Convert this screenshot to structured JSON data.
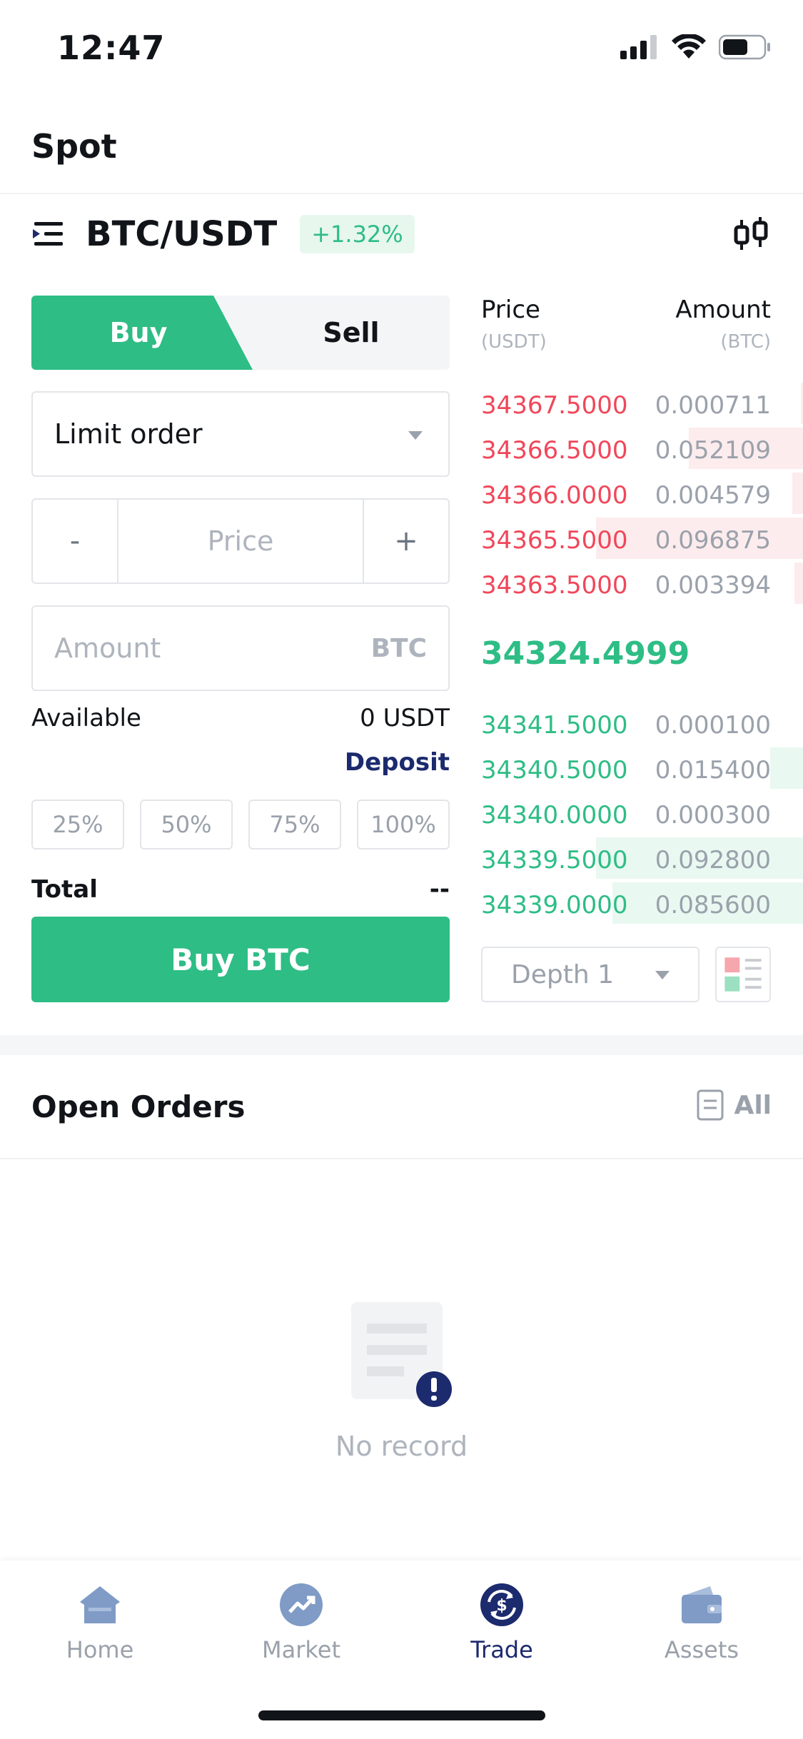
{
  "status": {
    "time": "12:47"
  },
  "header": {
    "title": "Spot"
  },
  "pair": {
    "name": "BTC/USDT",
    "change": "+1.32%"
  },
  "tabs": {
    "buy": "Buy",
    "sell": "Sell"
  },
  "form": {
    "order_type": "Limit order",
    "price_minus": "-",
    "price_placeholder": "Price",
    "price_plus": "+",
    "amount_placeholder": "Amount",
    "amount_unit": "BTC",
    "available_label": "Available",
    "available_value": "0 USDT",
    "deposit": "Deposit",
    "percentages": [
      "25%",
      "50%",
      "75%",
      "100%"
    ],
    "total_label": "Total",
    "total_value": "--",
    "submit": "Buy BTC"
  },
  "orderbook": {
    "price_header": "Price",
    "price_unit": "(USDT)",
    "amount_header": "Amount",
    "amount_unit": "(BTC)",
    "asks": [
      {
        "price": "34367.5000",
        "amount": "0.000711",
        "depth": 0.01
      },
      {
        "price": "34366.5000",
        "amount": "0.052109",
        "depth": 0.55
      },
      {
        "price": "34366.0000",
        "amount": "0.004579",
        "depth": 0.05
      },
      {
        "price": "34365.5000",
        "amount": "0.096875",
        "depth": 1.0
      },
      {
        "price": "34363.5000",
        "amount": "0.003394",
        "depth": 0.04
      }
    ],
    "last_price": "34324.4999",
    "bids": [
      {
        "price": "34341.5000",
        "amount": "0.000100",
        "depth": 0.0
      },
      {
        "price": "34340.5000",
        "amount": "0.015400",
        "depth": 0.16
      },
      {
        "price": "34340.0000",
        "amount": "0.000300",
        "depth": 0.0
      },
      {
        "price": "34339.5000",
        "amount": "0.092800",
        "depth": 1.0
      },
      {
        "price": "34339.0000",
        "amount": "0.085600",
        "depth": 0.92
      }
    ],
    "depth_select": "Depth 1"
  },
  "open_orders": {
    "title": "Open Orders",
    "all": "All",
    "empty": "No record"
  },
  "nav": [
    {
      "label": "Home",
      "icon": "home-icon"
    },
    {
      "label": "Market",
      "icon": "market-icon"
    },
    {
      "label": "Trade",
      "icon": "trade-icon"
    },
    {
      "label": "Assets",
      "icon": "assets-icon"
    }
  ],
  "colors": {
    "accent_green": "#2ebd85",
    "ask_red": "#f0475a",
    "brand_navy": "#1c2a6e"
  }
}
